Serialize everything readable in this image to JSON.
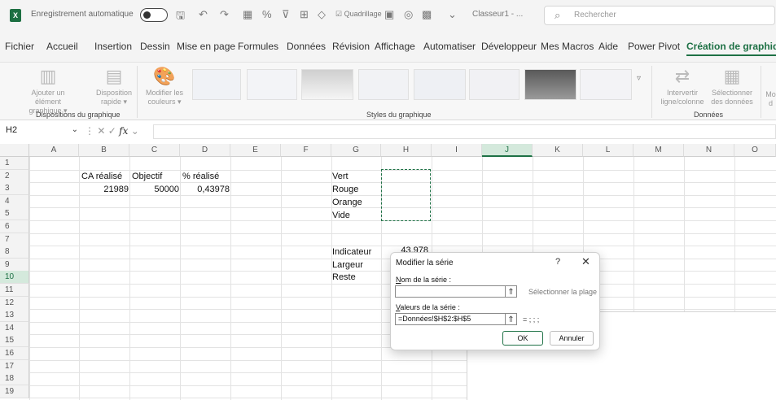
{
  "titlebar": {
    "autosave_label": "Enregistrement automatique",
    "quadrillage_label": "Quadrillage",
    "filename": "Classeur1 - ...",
    "search_placeholder": "Rechercher"
  },
  "tabs": [
    "Fichier",
    "Accueil",
    "Insertion",
    "Dessin",
    "Mise en page",
    "Formules",
    "Données",
    "Révision",
    "Affichage",
    "Automatiser",
    "Développeur",
    "Mes Macros",
    "Aide",
    "Power Pivot",
    "Création de graphique"
  ],
  "active_tab": "Création de graphique",
  "ribbon": {
    "add_element": [
      "Ajouter un élément",
      "graphique ▾"
    ],
    "quick_layout": [
      "Disposition",
      "rapide ▾"
    ],
    "change_colors": [
      "Modifier les",
      "couleurs ▾"
    ],
    "group_layouts": "Dispositions du graphique",
    "group_styles": "Styles du graphique",
    "switch_row_col": [
      "Intervertir",
      "ligne/colonne"
    ],
    "select_data": [
      "Sélectionner",
      "des données"
    ],
    "group_data": "Données",
    "cut_label": [
      "Mo",
      "d"
    ]
  },
  "formula_bar": {
    "name_box": "H2",
    "fx": "fx",
    "content": ""
  },
  "columns": [
    "A",
    "B",
    "C",
    "D",
    "E",
    "F",
    "G",
    "H",
    "I",
    "J",
    "K",
    "L",
    "M",
    "N",
    "O"
  ],
  "selected_column": "J",
  "rows": [
    "1",
    "2",
    "3",
    "4",
    "5",
    "6",
    "7",
    "8",
    "9",
    "10",
    "11",
    "12",
    "13",
    "14",
    "15",
    "16",
    "17",
    "18",
    "19"
  ],
  "selected_row": "10",
  "cells": {
    "B2": "CA réalisé",
    "C2": "Objectif",
    "D2": "% réalisé",
    "B3": "21989",
    "C3": "50000",
    "D3": "0,43978",
    "G2": "Vert",
    "G3": "Rouge",
    "G4": "Orange",
    "G5": "Vide",
    "G8": "Indicateur",
    "H8": "43,978",
    "G9": "Largeur",
    "G10": "Reste"
  },
  "dialog": {
    "title": "Modifier la série",
    "help": "?",
    "close": "✕",
    "name_label_u": "N",
    "name_label_rest": "om de la série :",
    "name_value": "",
    "select_range": "Sélectionner la plage",
    "values_label_u": "V",
    "values_label_rest": "aleurs de la série :",
    "values_value": "=Données!$H$2:$H$5",
    "values_preview": "= ; ; ;",
    "ok": "OK",
    "cancel": "Annuler"
  },
  "colors": {
    "accent": "#1e7145",
    "excel_green": "#1d6f42"
  }
}
